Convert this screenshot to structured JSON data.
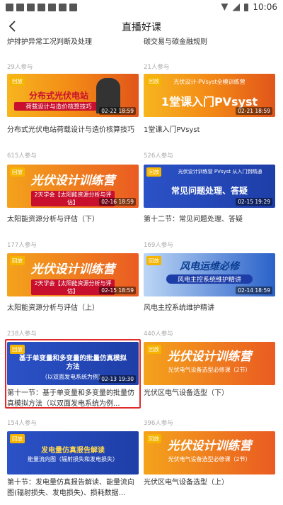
{
  "status": {
    "time": "10:06"
  },
  "header": {
    "title": "直播好课"
  },
  "top": {
    "left_title": "炉排护异常工况判断及处理",
    "right_title": "碳交易与碳金融规则"
  },
  "rows": [
    {
      "left": {
        "participants": "29人参与",
        "badge": "回放",
        "time": "02-22 18:59",
        "thumb_main": "分布式光伏电站",
        "thumb_sub": "荷载设计与造价核算技巧",
        "title": "分布式光伏电站荷载设计与造价核算技巧"
      },
      "right": {
        "participants": "21人参与",
        "badge": "回放",
        "time": "02-21 18:59",
        "thumb_main": "1堂课入门PVsyst",
        "thumb_sub": "光伏设计-PVsyst全模训练营",
        "title": "1堂课入门PVsyst"
      }
    },
    {
      "left": {
        "participants": "615人参与",
        "badge": "回放",
        "time": "02-16 18:59",
        "thumb_main": "光伏设计训练营",
        "thumb_sub": "2天学会【太阳能资源分析与评估】",
        "title": "太阳能资源分析与评估（下）"
      },
      "right": {
        "participants": "526人参与",
        "badge": "回放",
        "time": "02-15 19:29",
        "thumb_main": "常见问题处理、答疑",
        "thumb_sub": "光伏设计训练营 PVsyst 从入门到精通",
        "title": "第十二节：常见问题处理、答疑"
      }
    },
    {
      "left": {
        "participants": "177人参与",
        "badge": "回放",
        "time": "02-15 18:59",
        "thumb_main": "光伏设计训练营",
        "thumb_sub": "2天学会【太阳能资源分析与评估】",
        "title": "太阳能资源分析与评估（上）"
      },
      "right": {
        "participants": "169人参与",
        "badge": "回放",
        "time": "02-14 18:59",
        "thumb_main": "风电运维必修",
        "thumb_sub": "风电主控系统维护精讲",
        "title": "风电主控系统维护精讲"
      }
    },
    {
      "left": {
        "participants": "238人参与",
        "badge": "回放",
        "time": "02-13 19:30",
        "thumb_main": "基于单变量和多变量的批量仿真模拟方法",
        "thumb_sub": "（以双面发电系统为例）",
        "title": "第十一节：基于单变量和多变量的批量仿真模拟方法（以双面发电系统为例...",
        "footer": "154人参与"
      },
      "right": {
        "participants": "440人参与",
        "badge": "回放",
        "time": "",
        "thumb_main": "光伏设计训练营",
        "thumb_sub": "光伏电气设备选型必修课（2节）",
        "title": "光伏区电气设备选型（下）",
        "footer": "396人参与"
      }
    },
    {
      "left": {
        "participants": "",
        "badge": "回放",
        "time": "",
        "thumb_main": "发电量仿真报告解读",
        "thumb_sub": "能量流向图（辐射损失和发电损失）",
        "title": "第十节：发电量仿真报告解读、能量流向图(辐射损失、发电损失)、损耗数据..."
      },
      "right": {
        "participants": "",
        "badge": "回放",
        "time": "",
        "thumb_main": "光伏设计训练营",
        "thumb_sub": "光伏电气设备选型必修课（2节）",
        "title": "光伏区电气设备选型（上）"
      }
    }
  ],
  "colors": {
    "badge": "#f5b400",
    "selection": "#e12b2b",
    "orange": "#f38a16",
    "blue": "#1e3ea7"
  }
}
